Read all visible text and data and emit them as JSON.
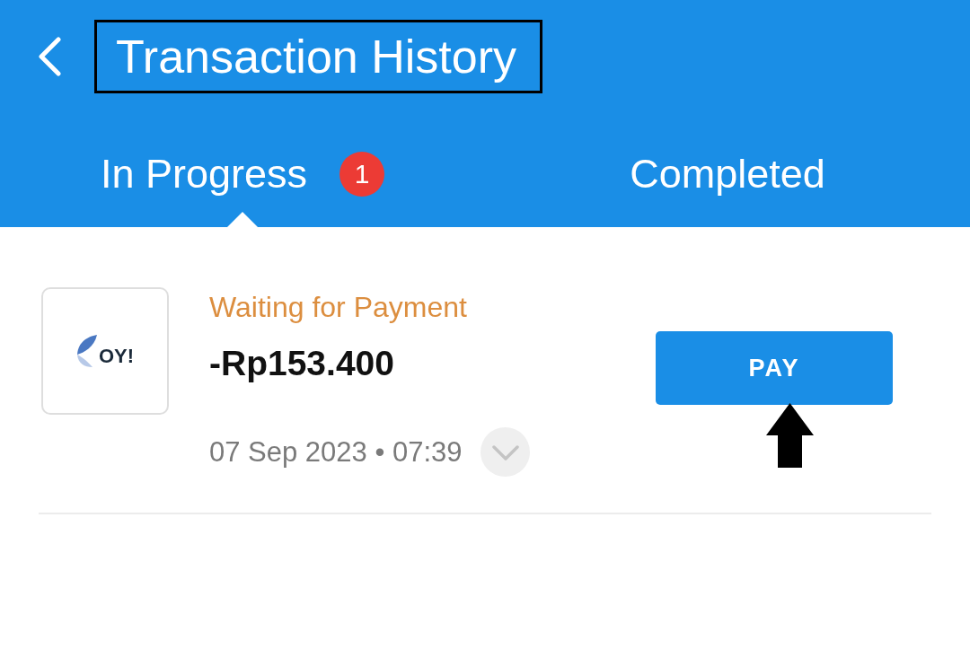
{
  "header": {
    "title": "Transaction History"
  },
  "tabs": [
    {
      "label": "In Progress",
      "selected": true,
      "badge": "1"
    },
    {
      "label": "Completed",
      "selected": false
    }
  ],
  "transactions": [
    {
      "logo_text": "OY!",
      "status": "Waiting for Payment",
      "amount": "-Rp153.400",
      "datetime": "07 Sep 2023 • 07:39",
      "expanded": false,
      "action": "PAY"
    }
  ],
  "annotations": {
    "title_box": true,
    "action_arrow": true
  }
}
